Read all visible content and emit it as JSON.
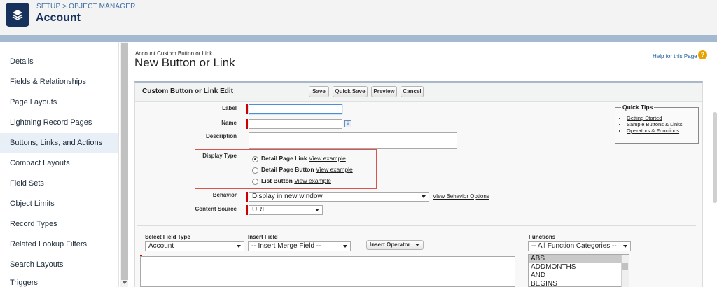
{
  "header": {
    "breadcrumb": "SETUP > OBJECT MANAGER",
    "title": "Account"
  },
  "sidebar": {
    "items": [
      {
        "label": "Details"
      },
      {
        "label": "Fields & Relationships"
      },
      {
        "label": "Page Layouts"
      },
      {
        "label": "Lightning Record Pages"
      },
      {
        "label": "Buttons, Links, and Actions",
        "active": true
      },
      {
        "label": "Compact Layouts"
      },
      {
        "label": "Field Sets"
      },
      {
        "label": "Object Limits"
      },
      {
        "label": "Record Types"
      },
      {
        "label": "Related Lookup Filters"
      },
      {
        "label": "Search Layouts"
      },
      {
        "label": "Triggers"
      }
    ]
  },
  "page": {
    "crumb": "Account Custom Button or Link",
    "title": "New Button or Link",
    "help_link": "Help for this Page",
    "help_icon": "?"
  },
  "panel": {
    "title": "Custom Button or Link Edit",
    "buttons": {
      "save": "Save",
      "quick_save": "Quick Save",
      "preview": "Preview",
      "cancel": "Cancel"
    },
    "fields": {
      "label_label": "Label",
      "name_label": "Name",
      "description_label": "Description",
      "display_type_label": "Display Type",
      "behavior_label": "Behavior",
      "content_source_label": "Content Source",
      "info_icon": "i"
    },
    "display_type": {
      "options": [
        {
          "label": "Detail Page Link",
          "link": "View example",
          "checked": true
        },
        {
          "label": "Detail Page Button",
          "link": "View example",
          "checked": false
        },
        {
          "label": "List Button",
          "link": "View example",
          "checked": false
        }
      ]
    },
    "behavior": {
      "value": "Display in new window",
      "link": "View Behavior Options"
    },
    "content_source": {
      "value": "URL"
    },
    "quick_tips": {
      "title": "Quick Tips",
      "links": [
        "Getting Started",
        "Sample Buttons & Links",
        "Operators & Functions"
      ]
    },
    "formula": {
      "select_field_type_label": "Select Field Type",
      "select_field_type_value": "Account",
      "insert_field_label": "Insert Field",
      "insert_field_value": "-- Insert Merge Field --",
      "insert_operator": "Insert Operator",
      "functions_label": "Functions",
      "functions_category": "-- All Function Categories --",
      "functions_list": [
        "ABS",
        "ADDMONTHS",
        "AND",
        "BEGINS"
      ]
    }
  }
}
